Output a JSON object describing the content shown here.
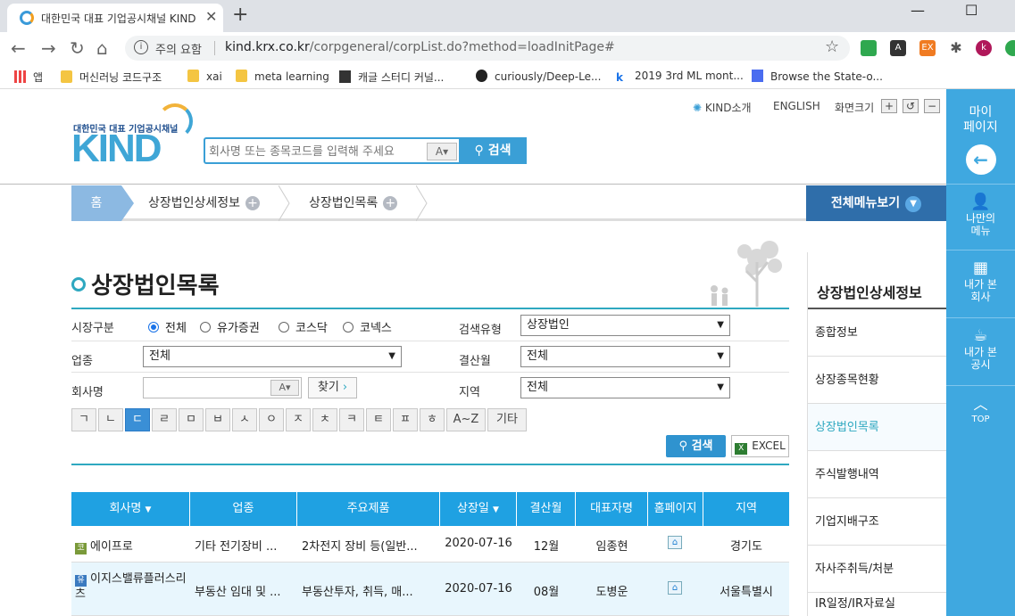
{
  "browser": {
    "tab_title": "대한민국 대표 기업공시채널 KIND",
    "tab_close": "✕",
    "new_tab": "+",
    "omnibox_warning": "주의 요함",
    "url_host": "kind.krx.co.kr",
    "url_path": "/corpgeneral/corpList.do?method=loadInitPage#",
    "profile_initial": "k",
    "bookmarks": [
      "앱",
      "머신러닝 코드구조",
      "xai",
      "meta learning",
      "캐글 스터디 커널...",
      "curiously/Deep-Le...",
      "2019 3rd ML mont...",
      "Browse the State-o..."
    ]
  },
  "site": {
    "logo_sub": "대한민국 대표 기업공시채널",
    "logo": "KIND",
    "search_placeholder": "회사명 또는 종목코드를 입력해 주세요",
    "search_ab": "A▾",
    "search_button": "검색",
    "util_links": {
      "about": "KIND소개",
      "english": "ENGLISH",
      "zoom": "화면크기"
    },
    "breadcrumb": {
      "home": "홈",
      "item1": "상장법인상세정보",
      "item2": "상장법인목록",
      "all_menu": "전체메뉴보기"
    },
    "page_title": "상장법인목록"
  },
  "filters": {
    "market_label": "시장구분",
    "market_options": [
      "전체",
      "유가증권",
      "코스닥",
      "코넥스"
    ],
    "market_selected": "전체",
    "search_type_label": "검색유형",
    "search_type_value": "상장법인",
    "industry_label": "업종",
    "industry_value": "전체",
    "fiscal_label": "결산월",
    "fiscal_value": "전체",
    "company_label": "회사명",
    "company_ab": "A▾",
    "find_button": "찾기",
    "region_label": "지역",
    "region_value": "전체",
    "consonants": [
      "ㄱ",
      "ㄴ",
      "ㄷ",
      "ㄹ",
      "ㅁ",
      "ㅂ",
      "ㅅ",
      "ㅇ",
      "ㅈ",
      "ㅊ",
      "ㅋ",
      "ㅌ",
      "ㅍ",
      "ㅎ",
      "A~Z",
      "기타"
    ],
    "consonant_selected": "ㄷ",
    "search_button": "검색",
    "excel_button": "EXCEL"
  },
  "table": {
    "headers": [
      "회사명",
      "업종",
      "주요제품",
      "상장일",
      "결산월",
      "대표자명",
      "홈페이지",
      "지역"
    ],
    "rows": [
      {
        "market_mark": "코",
        "name": "에이프로",
        "industry": "기타 전기장비 ...",
        "product": "2차전지 장비 등(일반...",
        "listed": "2020-07-16",
        "fiscal": "12월",
        "ceo": "임종현",
        "region": "경기도"
      },
      {
        "market_mark": "유",
        "name": "이지스밸류플러스리츠",
        "industry": "부동산 임대 및 ...",
        "product": "부동산투자, 취득, 매...",
        "listed": "2020-07-16",
        "fiscal": "08월",
        "ceo": "도병운",
        "region": "서울특별시"
      }
    ]
  },
  "right_panel": {
    "title": "상장법인상세정보",
    "items": [
      "종합정보",
      "상장종목현황",
      "상장법인목록",
      "주식발행내역",
      "기업지배구조",
      "자사주취득/처분",
      "IR일정/IR자료실"
    ],
    "selected": "상장법인목록"
  },
  "sidebar": {
    "mypage": "마이\n페이지",
    "my_menu": "나만의\n메뉴",
    "viewed_company": "내가 본\n회사",
    "viewed_disclosure": "내가 본\n공시",
    "top": "TOP"
  }
}
